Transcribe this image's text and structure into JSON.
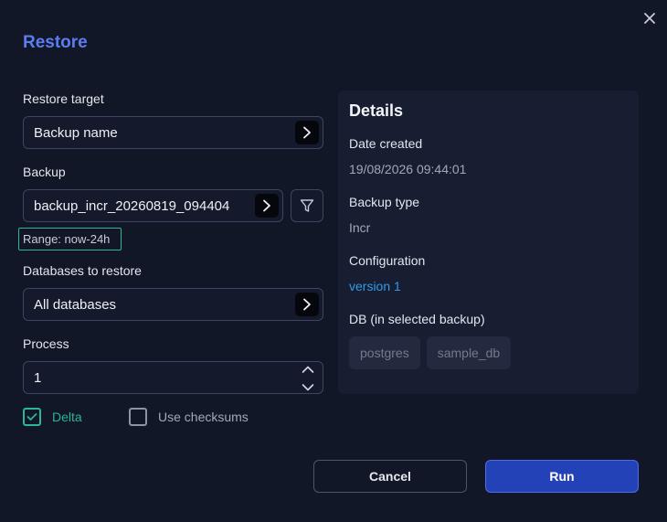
{
  "dialog": {
    "title": "Restore",
    "close_icon": "close-icon"
  },
  "form": {
    "restore_target": {
      "label": "Restore target",
      "value": "Backup name"
    },
    "backup": {
      "label": "Backup",
      "value": "backup_incr_20260819_094404",
      "range": "Range: now-24h"
    },
    "databases": {
      "label": "Databases to restore",
      "value": "All databases"
    },
    "process": {
      "label": "Process",
      "value": "1"
    },
    "delta": {
      "label": "Delta",
      "checked": true
    },
    "checksums": {
      "label": "Use checksums",
      "checked": false
    }
  },
  "details": {
    "title": "Details",
    "date_created": {
      "label": "Date created",
      "value": "19/08/2026 09:44:01"
    },
    "backup_type": {
      "label": "Backup type",
      "value": "Incr"
    },
    "configuration": {
      "label": "Configuration",
      "value": "version 1"
    },
    "db": {
      "label": "DB (in selected backup)",
      "items": [
        "postgres",
        "sample_db"
      ]
    }
  },
  "actions": {
    "cancel": "Cancel",
    "run": "Run"
  },
  "colors": {
    "background": "#111726",
    "accent_title": "#5c7cf0",
    "accent_teal": "#2bb59a",
    "link": "#2f9be8",
    "run_button": "#2442b8"
  }
}
